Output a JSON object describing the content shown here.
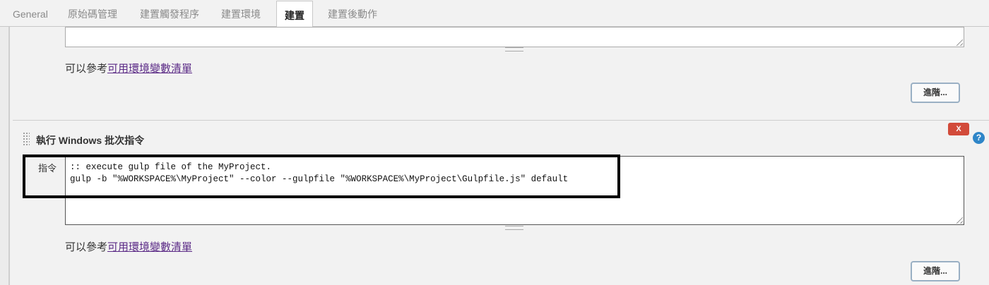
{
  "tabs": [
    {
      "label": "General"
    },
    {
      "label": "原始碼管理"
    },
    {
      "label": "建置觸發程序"
    },
    {
      "label": "建置環境"
    },
    {
      "label": "建置",
      "active": true
    },
    {
      "label": "建置後動作"
    }
  ],
  "upper_section": {
    "hint_prefix": "可以參考",
    "hint_link": "可用環境變數清單",
    "advanced_button": "進階..."
  },
  "batch_section": {
    "title": "執行 Windows 批次指令",
    "delete_button": "X",
    "help_button": "?",
    "field_label": "指令",
    "command_lines": [
      ":: execute gulp file of the MyProject.",
      "gulp -b \"%WORKSPACE%\\MyProject\" --color --gulpfile \"%WORKSPACE%\\MyProject\\Gulpfile.js\" default"
    ],
    "hint_prefix": "可以參考",
    "hint_link": "可用環境變數清單",
    "advanced_button": "進階..."
  },
  "colors": {
    "highlight_border": "#000000",
    "delete_button_bg": "#d24b3a",
    "help_button_bg": "#2f86c8",
    "link": "#5b2a86"
  }
}
